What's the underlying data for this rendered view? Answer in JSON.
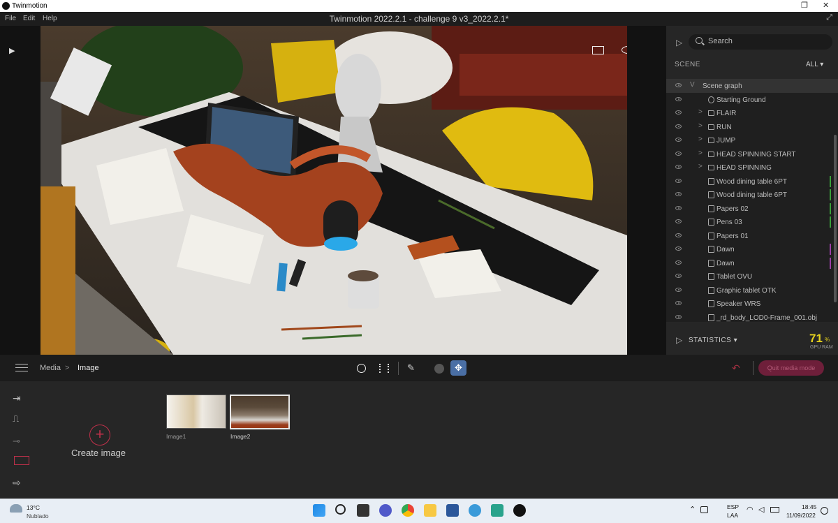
{
  "titlebar": {
    "app_name": "Twinmotion"
  },
  "appbar": {
    "menu": [
      "File",
      "Edit",
      "Help"
    ],
    "title": "Twinmotion 2022.2.1 - challenge 9 v3_2022.2.1*"
  },
  "panel": {
    "search_placeholder": "Search",
    "scene_label": "SCENE",
    "filter_label": "ALL",
    "tree": [
      {
        "label": "Scene graph",
        "type": "root",
        "selected": true
      },
      {
        "label": "Starting Ground",
        "type": "ground"
      },
      {
        "label": "FLAIR",
        "type": "folder"
      },
      {
        "label": "RUN",
        "type": "folder"
      },
      {
        "label": "JUMP",
        "type": "folder"
      },
      {
        "label": "HEAD SPINNING START",
        "type": "folder"
      },
      {
        "label": "HEAD SPINNING",
        "type": "folder"
      },
      {
        "label": "Wood dining table 6PT",
        "type": "object",
        "mark": "#3aa03a"
      },
      {
        "label": "Wood dining table 6PT",
        "type": "object",
        "mark": "#3aa03a"
      },
      {
        "label": "Papers 02",
        "type": "object",
        "mark": "#3aa03a"
      },
      {
        "label": "Pens 03",
        "type": "object",
        "mark": "#3aa03a"
      },
      {
        "label": "Papers 01",
        "type": "object"
      },
      {
        "label": "Dawn",
        "type": "object",
        "mark": "#9b3fa8"
      },
      {
        "label": "Dawn",
        "type": "object",
        "mark": "#9b3fa8"
      },
      {
        "label": "Tablet OVU",
        "type": "object"
      },
      {
        "label": "Graphic tablet OTK",
        "type": "object"
      },
      {
        "label": "Speaker WRS",
        "type": "object"
      },
      {
        "label": "_rd_body_LOD0-Frame_001.obj",
        "type": "object"
      }
    ],
    "statistics_label": "STATISTICS",
    "gpu_value": "71",
    "gpu_unit": "%",
    "gpu_label": "GPU RAM"
  },
  "toolbar": {
    "breadcrumb_parent": "Media",
    "breadcrumb_separator": ">",
    "breadcrumb_current": "Image",
    "exit_button": "Quit media mode"
  },
  "media": {
    "create_label": "Create image",
    "images": [
      {
        "label": "Image1",
        "selected": false
      },
      {
        "label": "Image2",
        "selected": true
      }
    ]
  },
  "taskbar": {
    "temperature": "13°C",
    "weather": "Nublado",
    "lang_top": "ESP",
    "lang_bottom": "LAA",
    "time": "18:45",
    "date": "11/09/2022"
  },
  "colors": {
    "accent_blue": "#4a6fa5",
    "exit_red": "#6e1f3a",
    "gpu_yellow": "#e6d21e",
    "create_red": "#c0304a"
  }
}
